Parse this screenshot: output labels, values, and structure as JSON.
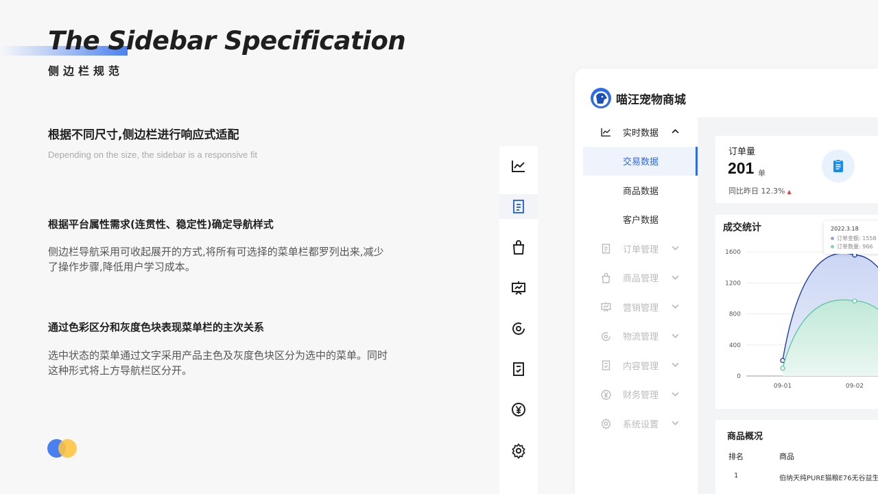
{
  "header": {
    "title_en": "The Sidebar Specification",
    "title_cn": "侧边栏规范"
  },
  "sections": [
    {
      "heading": "根据不同尺寸,侧边栏进行响应式适配",
      "subtitle": "Depending on the size, the sidebar is a responsive fit"
    },
    {
      "heading": "根据平台属性需求(连贯性、稳定性)确定导航样式",
      "body": [
        "侧边栏导航采用可收起展开的方式,将所有可选择的菜单栏都罗列出来,减少",
        "了操作步骤,降低用户学习成本。"
      ]
    },
    {
      "heading": "通过色彩区分和灰度色块表现菜单栏的主次关系",
      "body": [
        "选中状态的菜单通过文字采用产品主色及灰度色块区分为选中的菜单。同时",
        "这种形式将上方导航栏区分开。"
      ]
    }
  ],
  "colors": {
    "primary": "#2f6be6",
    "accent_blue": "#4a7ff0",
    "accent_yellow": "#fcc442",
    "chart_series_1": "#1b3f9e",
    "chart_series_2": "#5cc9a1"
  },
  "mini_sidebar": {
    "icons": [
      "chart-icon",
      "document-icon",
      "bag-icon",
      "presentation-icon",
      "logistics-icon",
      "checklist-icon",
      "yuan-icon",
      "gear-icon"
    ],
    "active_index": 1
  },
  "app": {
    "brand_name": "喵汪宠物商城",
    "nav": [
      {
        "label": "实时数据",
        "icon": "chart-icon",
        "expanded": true
      },
      {
        "label": "交易数据",
        "child": true,
        "active": true
      },
      {
        "label": "商品数据",
        "child": true
      },
      {
        "label": "客户数据",
        "child": true
      },
      {
        "label": "订单管理",
        "icon": "document-icon"
      },
      {
        "label": "商品管理",
        "icon": "bag-icon"
      },
      {
        "label": "营销管理",
        "icon": "presentation-icon"
      },
      {
        "label": "物流管理",
        "icon": "logistics-icon"
      },
      {
        "label": "内容管理",
        "icon": "checklist-icon"
      },
      {
        "label": "财务管理",
        "icon": "yuan-icon"
      },
      {
        "label": "系统设置",
        "icon": "gear-icon"
      }
    ],
    "stat": {
      "title": "订单量",
      "value": "201",
      "unit": "单",
      "compare": "同比昨日 12.3%"
    },
    "chart": {
      "title": "成交统计",
      "tooltip": {
        "date": "2022.3.18",
        "row1": "订单金额: 1558",
        "row2": "订单数量: 966"
      }
    },
    "goods": {
      "title": "商品概况",
      "headers": [
        "排名",
        "商品"
      ],
      "rows": [
        {
          "rank": "1",
          "name": "伯纳天纯PURE猫粮E76无谷益生"
        }
      ]
    }
  },
  "chart_data": {
    "type": "area",
    "title": "成交统计",
    "xlabel": "",
    "ylabel": "",
    "x_ticks": [
      "09-01",
      "09-02"
    ],
    "y_ticks": [
      0,
      400,
      800,
      1200,
      1600
    ],
    "ylim": [
      0,
      1600
    ],
    "grid": true,
    "series": [
      {
        "name": "订单金额",
        "points": [
          {
            "x": "09-01",
            "y": 200
          },
          {
            "x": "09-02",
            "y": 1558
          }
        ],
        "color": "#1b3f9e"
      },
      {
        "name": "订单数量",
        "points": [
          {
            "x": "09-01",
            "y": 100
          },
          {
            "x": "09-02",
            "y": 966
          }
        ],
        "color": "#5cc9a1"
      }
    ]
  }
}
